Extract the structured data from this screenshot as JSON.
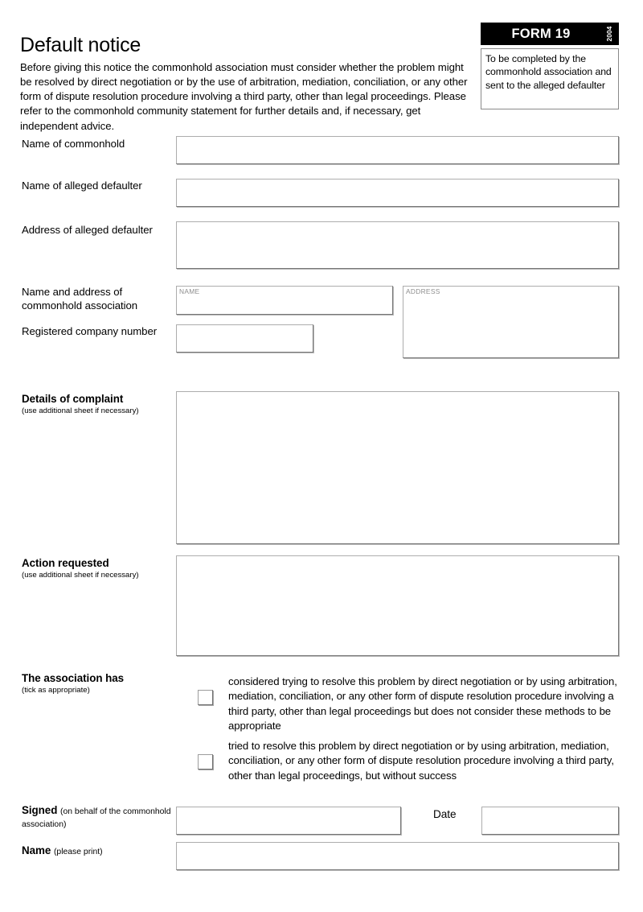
{
  "header": {
    "title": "Default notice",
    "intro": "Before giving this notice the commonhold association must consider whether the problem might be resolved by direct negotiation or by the use of arbitration, mediation, conciliation, or any other form of dispute resolution procedure involving a third party, other than legal proceedings. Please refer to the commonhold community statement for further details and, if necessary, get independent advice."
  },
  "badge": {
    "form_label": "FORM 19",
    "year": "2004",
    "note": "To be completed by the commonhold association and sent to the alleged defaulter"
  },
  "fields": {
    "name_of_commonhold": {
      "label": "Name of commonhold",
      "value": ""
    },
    "name_of_alleged_defaulter": {
      "label": "Name of alleged defaulter",
      "value": ""
    },
    "address_of_alleged_defaulter": {
      "label": "Address of alleged defaulter",
      "value": ""
    },
    "name_and_address_of_association": {
      "label": "Name and address of commonhold association",
      "name_placeholder": "NAME",
      "name_value": "",
      "address_placeholder": "ADDRESS",
      "address_value": ""
    },
    "registered_company_number": {
      "label": "Registered company number",
      "value": ""
    },
    "details_of_complaint": {
      "label": "Details of complaint",
      "sub": "(use additional sheet if necessary)",
      "value": ""
    },
    "action_requested": {
      "label": "Action requested",
      "sub": "(use additional sheet if necessary)",
      "value": ""
    },
    "signed": {
      "label": "Signed",
      "sub": "(on behalf of the commonhold association)",
      "value": ""
    },
    "date": {
      "label": "Date",
      "value": ""
    },
    "name_print": {
      "label": "Name",
      "sub": "(please print)",
      "value": ""
    }
  },
  "association_has": {
    "label": "The association has",
    "sub": "(tick as appropriate)",
    "options": [
      {
        "text": "considered trying to resolve this problem by direct negotiation or by using arbitration, mediation, conciliation, or any other form of dispute resolution procedure involving a third party, other than legal proceedings but does not consider these methods to be appropriate",
        "checked": false
      },
      {
        "text": "tried to resolve this problem by direct negotiation or by using arbitration, mediation, conciliation, or any other form of dispute resolution procedure involving a third party, other than legal proceedings, but without success",
        "checked": false
      }
    ]
  }
}
